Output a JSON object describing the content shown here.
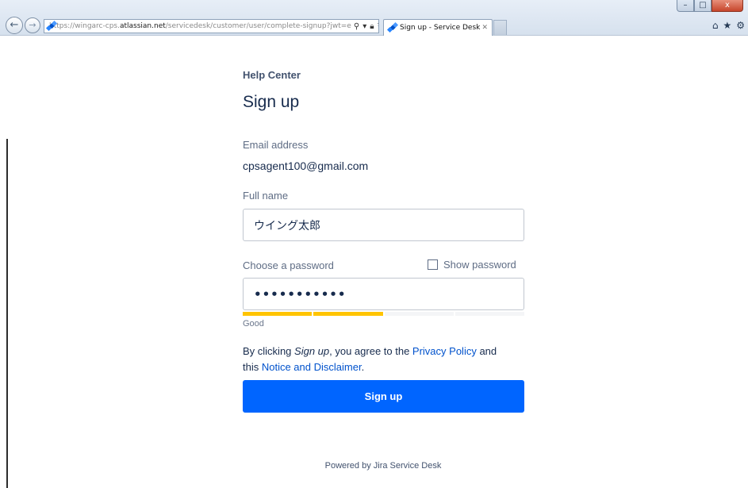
{
  "browser": {
    "url_prefix": "https://wingarc-cps.",
    "url_domain": "atlassian.net",
    "url_path": "/servicedesk/customer/user/complete-signup?jwt=e",
    "tab_title": "Sign up - Service Desk",
    "window_controls": {
      "minimize": "–",
      "maximize": "□",
      "close": "x"
    }
  },
  "page": {
    "help_center": "Help Center",
    "title": "Sign up",
    "email_label": "Email address",
    "email_value": "cpsagent100@gmail.com",
    "fullname_label": "Full name",
    "fullname_value": "ウイング太郎",
    "password_label": "Choose a password",
    "show_password_label": "Show password",
    "password_value": "•••••••••••",
    "strength_label": "Good",
    "strength_level": 0.5,
    "terms": {
      "prefix": "By clicking ",
      "action": "Sign up",
      "middle": ", you agree to the ",
      "privacy_link": "Privacy Policy",
      "and": " and",
      "this": "this ",
      "notice_link": "Notice and Disclaimer",
      "suffix": "."
    },
    "signup_button": "Sign up",
    "powered_by": "Powered by Jira Service Desk"
  },
  "colors": {
    "primary_button": "#0065ff",
    "link": "#0052cc",
    "strength_good": "#ffc400"
  }
}
